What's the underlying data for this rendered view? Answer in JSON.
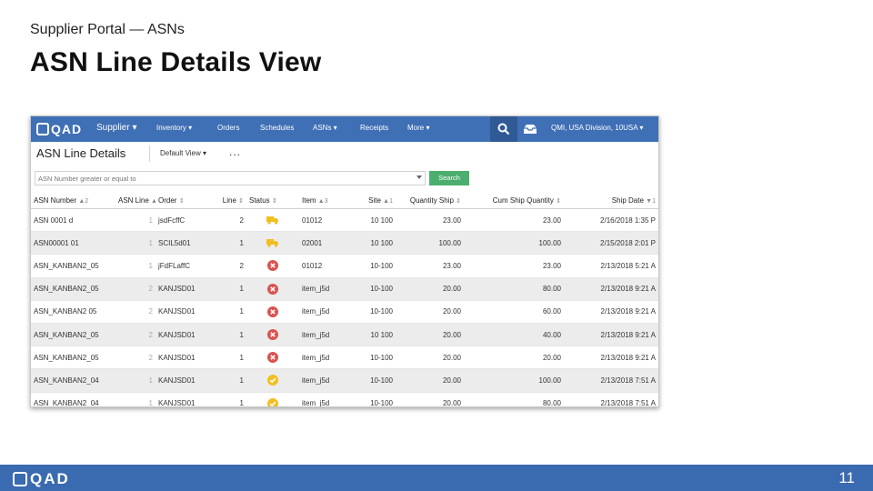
{
  "slide": {
    "subtitle": "Supplier Portal — ASNs",
    "title": "ASN Line Details View",
    "page_number": "11",
    "footer_logo": "QAD"
  },
  "app": {
    "logo": "QAD",
    "nav": [
      "Supplier",
      "Inventory",
      "Orders",
      "Schedules",
      "ASNs",
      "Receipts",
      "More"
    ],
    "entity": "QMI, USA Division, 10USA",
    "toolbar_title": "ASN Line Details",
    "view_label": "Default View",
    "more_label": "...",
    "filter_placeholder": "ASN Number greater or equal to",
    "search_label": "Search"
  },
  "table": {
    "headers": [
      "ASN Number",
      "ASN Line",
      "Order",
      "Line",
      "Status",
      "Item",
      "Site",
      "Quantity Ship",
      "Cum Ship Quantity",
      "Ship Date"
    ],
    "header_sort": [
      "▲2",
      "▲4",
      "⇕",
      "⇕",
      "⇕",
      "▲3",
      "▲1",
      "⇕",
      "⇕",
      "▼1"
    ],
    "rows": [
      {
        "asn": "ASN 0001 d",
        "line": "1",
        "order": "jsdFcffC",
        "oline": "2",
        "status": "truck",
        "item": "01012",
        "site": "10 100",
        "qty": "23.00",
        "cum": "23.00",
        "date": "2/16/2018 1:35 P"
      },
      {
        "asn": "ASN00001 01",
        "line": "1",
        "order": "SCIL5d01",
        "oline": "1",
        "status": "truck",
        "item": "02001",
        "site": "10 100",
        "qty": "100.00",
        "cum": "100.00",
        "date": "2/15/2018 2:01 P"
      },
      {
        "asn": "ASN_KANBAN2_05",
        "line": "1",
        "order": "jFdFLaffC",
        "oline": "2",
        "status": "error",
        "item": "01012",
        "site": "10-100",
        "qty": "23.00",
        "cum": "23.00",
        "date": "2/13/2018 5:21 A"
      },
      {
        "asn": "ASN_KANBAN2_05",
        "line": "2",
        "order": "KANJSD01",
        "oline": "1",
        "status": "error",
        "item": "item_j5d",
        "site": "10-100",
        "qty": "20.00",
        "cum": "80.00",
        "date": "2/13/2018 9:21 A"
      },
      {
        "asn": "ASN_KANBAN2 05",
        "line": "2",
        "order": "KANJSD01",
        "oline": "1",
        "status": "error",
        "item": "item_j5d",
        "site": "10-100",
        "qty": "20.00",
        "cum": "60.00",
        "date": "2/13/2018 9:21 A"
      },
      {
        "asn": "ASN_KANBAN2_05",
        "line": "2",
        "order": "KANJSD01",
        "oline": "1",
        "status": "error",
        "item": "item_j5d",
        "site": "10 100",
        "qty": "20.00",
        "cum": "40.00",
        "date": "2/13/2018 9:21 A"
      },
      {
        "asn": "ASN_KANBAN2_05",
        "line": "2",
        "order": "KANJSD01",
        "oline": "1",
        "status": "error",
        "item": "item_j5d",
        "site": "10-100",
        "qty": "20.00",
        "cum": "20.00",
        "date": "2/13/2018 9:21 A"
      },
      {
        "asn": "ASN_KANBAN2_04",
        "line": "1",
        "order": "KANJSD01",
        "oline": "1",
        "status": "ok",
        "item": "item_j5d",
        "site": "10-100",
        "qty": "20.00",
        "cum": "100.00",
        "date": "2/13/2018 7:51 A"
      },
      {
        "asn": "ASN_KANBAN2_04",
        "line": "1",
        "order": "KANJSD01",
        "oline": "1",
        "status": "ok",
        "item": "item_j5d",
        "site": "10-100",
        "qty": "20.00",
        "cum": "80.00",
        "date": "2/13/2018 7:51 A"
      }
    ]
  },
  "colors": {
    "brand_blue": "#3f6fb5",
    "truck": "#f1bf1f",
    "error": "#d9534f",
    "ok": "#f1bf1f",
    "search_green": "#4cae6e"
  },
  "icons": {
    "truck": "truck-icon",
    "error": "error-x-icon",
    "ok": "checkmark-circle-icon",
    "search": "search-icon",
    "inbox": "inbox-icon"
  }
}
